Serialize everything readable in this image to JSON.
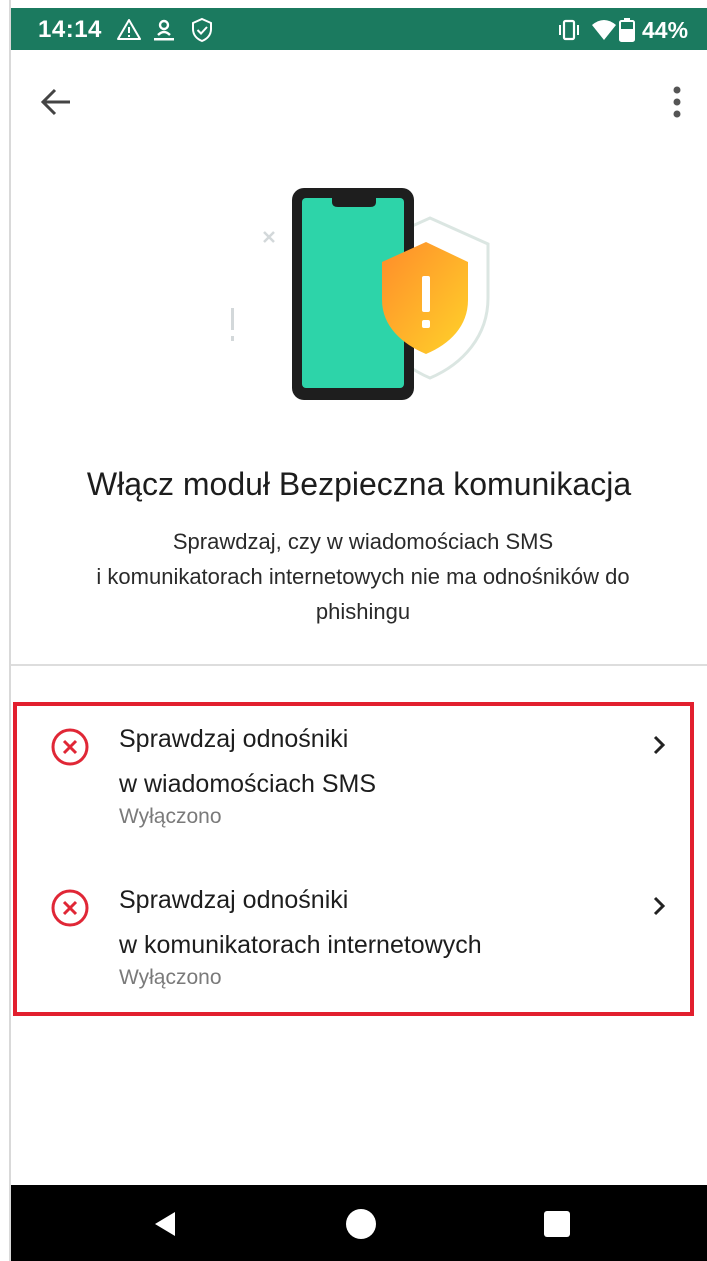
{
  "status_bar": {
    "time": "14:14",
    "battery_text": "44%",
    "icons": [
      "warning-icon",
      "cast-icon",
      "shield-check-icon",
      "vibrate-icon",
      "wifi-icon",
      "battery-icon"
    ],
    "background": "#1b7a5f"
  },
  "app_bar": {
    "back_icon": "arrow-back-icon",
    "menu_icon": "more-vert-icon"
  },
  "hero": {
    "title": "Włącz moduł Bezpieczna komunikacja",
    "description_line1": "Sprawdzaj, czy w wiadomościach SMS",
    "description_line2": "i komunikatorach internetowych nie ma odnośników do",
    "description_line3": "phishingu"
  },
  "settings": [
    {
      "title_line1": "Sprawdzaj odnośniki",
      "title_line2": "w wiadomościach SMS",
      "status": "Wyłączono",
      "icon": "error-circle-icon"
    },
    {
      "title_line1": "Sprawdzaj odnośniki",
      "title_line2": "w komunikatorach internetowych",
      "status": "Wyłączono",
      "icon": "error-circle-icon"
    }
  ],
  "colors": {
    "accent_green": "#1b7a5f",
    "phone_screen": "#2dd4a9",
    "shield_orange": "#ffb020",
    "error_red": "#e02736",
    "highlight_red": "#e21f2e"
  },
  "nav_bar": {
    "icons": [
      "nav-back-icon",
      "nav-home-icon",
      "nav-recents-icon"
    ]
  }
}
